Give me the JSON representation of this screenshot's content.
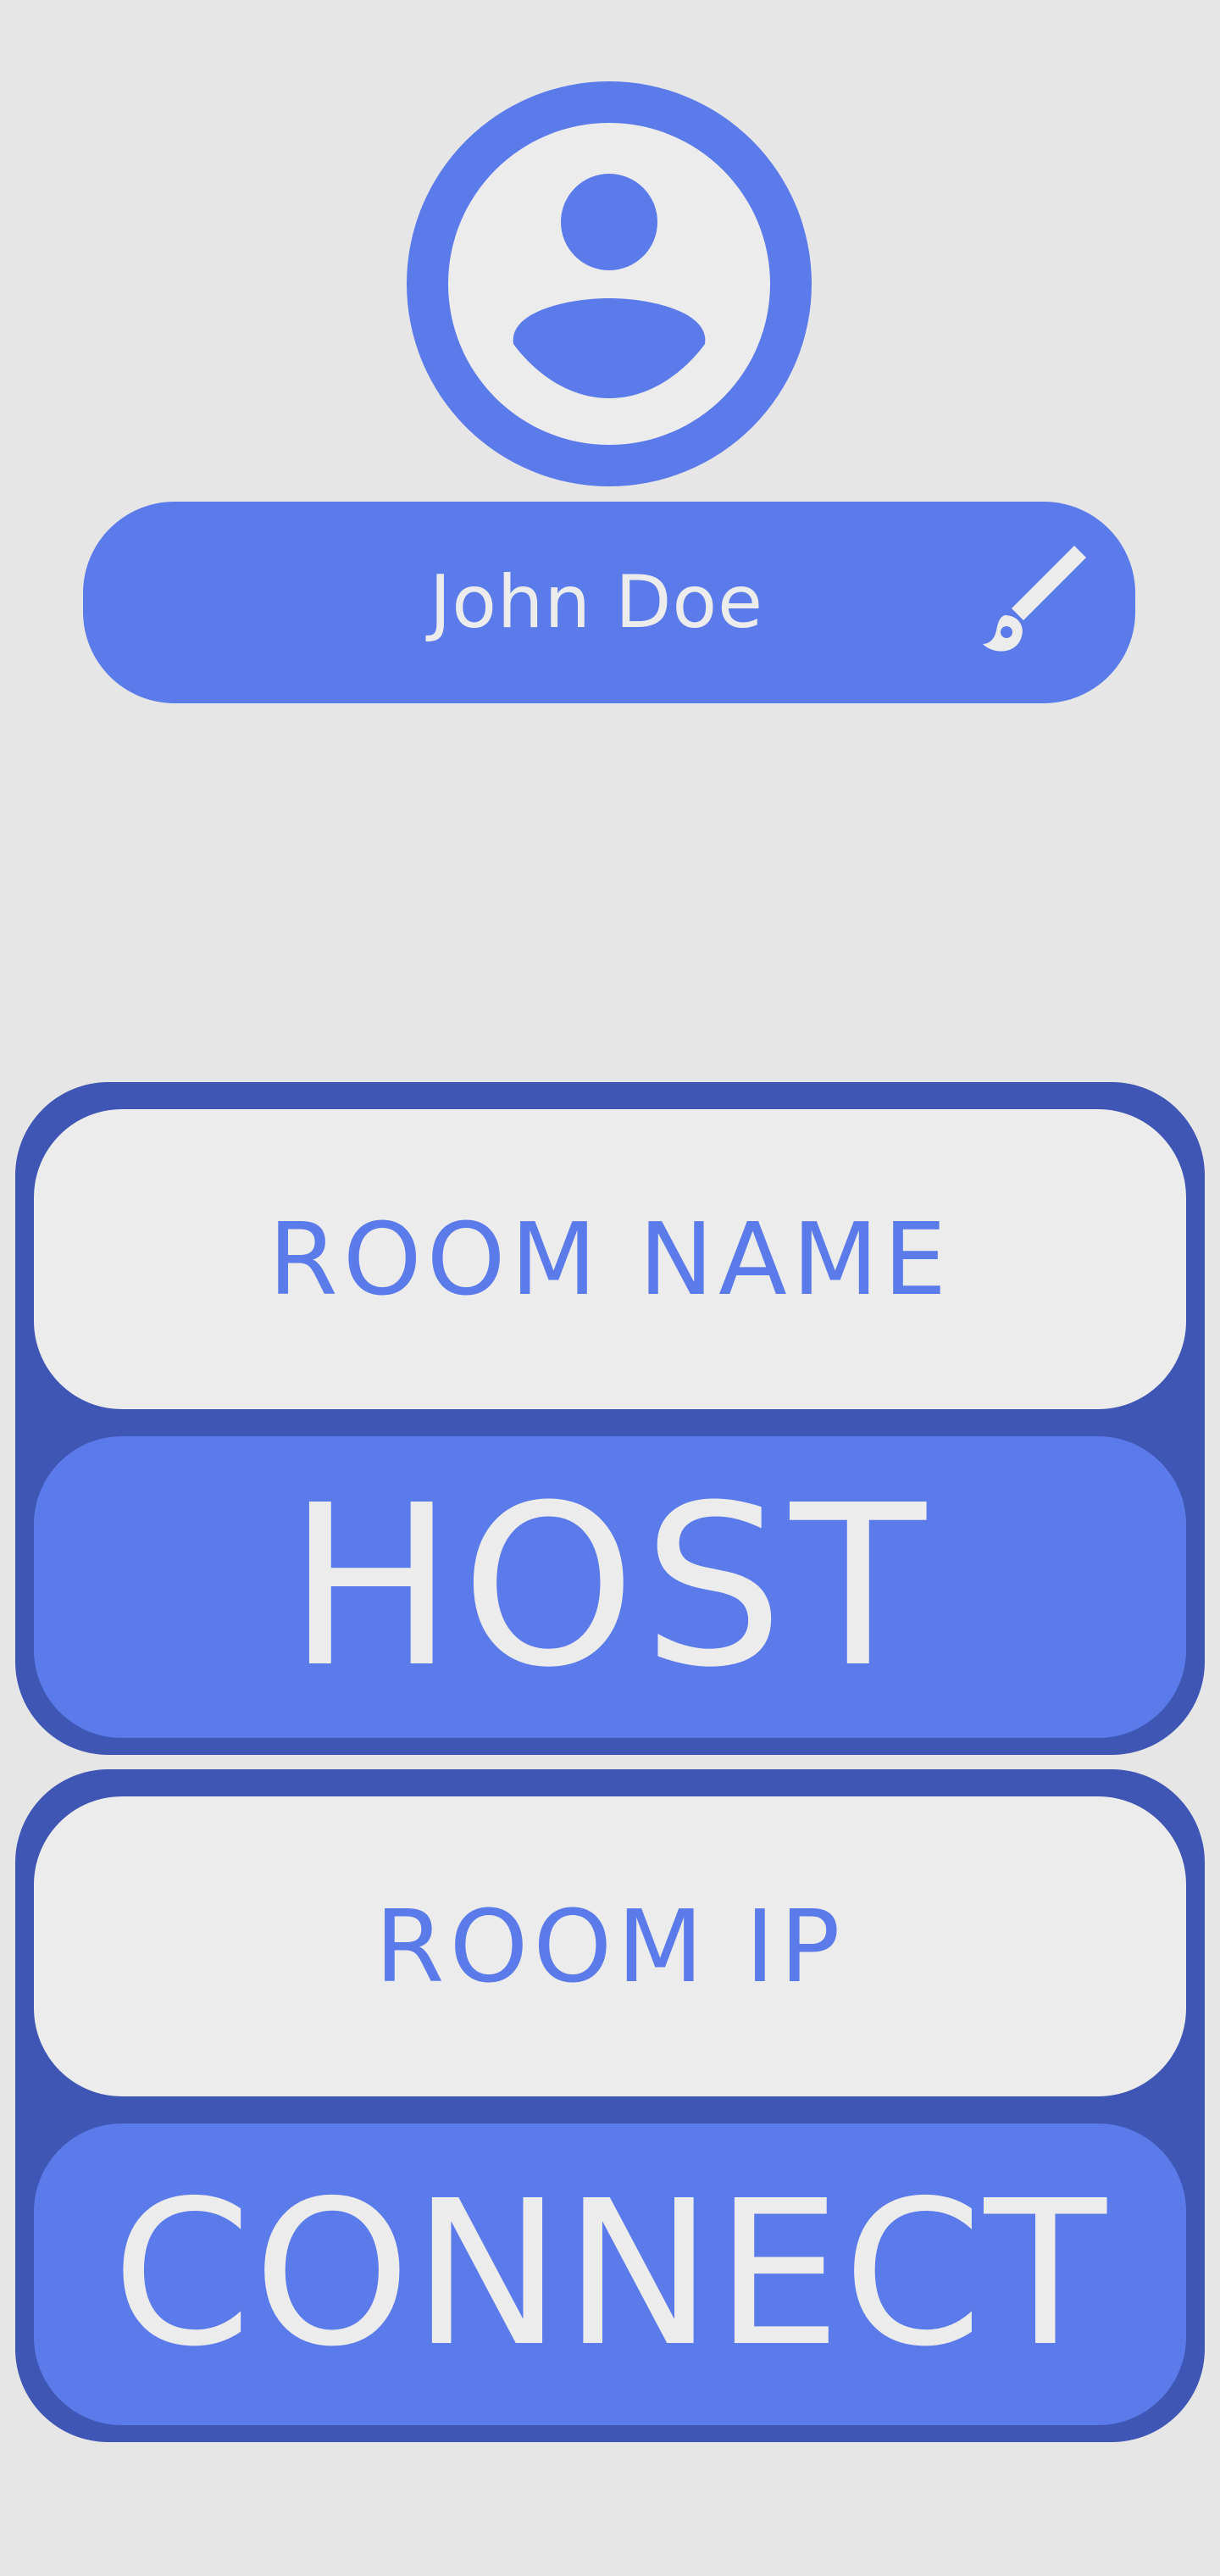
{
  "profile": {
    "name": "John Doe",
    "avatar_icon": "account-circle-icon",
    "edit_icon": "paint-brush-icon"
  },
  "host_section": {
    "room_name_placeholder": "ROOM NAME",
    "host_button_label": "HOST"
  },
  "connect_section": {
    "room_ip_placeholder": "ROOM IP",
    "connect_button_label": "CONNECT"
  },
  "colors": {
    "background": "#e6e6e6",
    "primary": "#5c7bea",
    "primary_dark": "#3f56b4",
    "light": "#ececec"
  }
}
